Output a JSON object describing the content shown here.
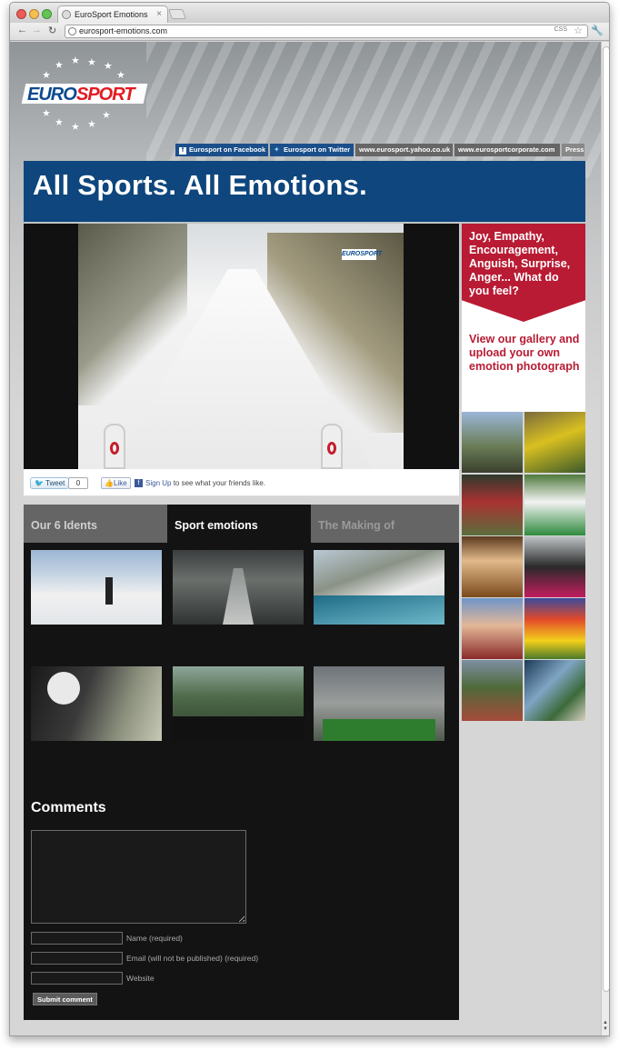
{
  "browser": {
    "tab_title": "EuroSport Emotions",
    "url": "eurosport-emotions.com",
    "url_badge": "CSS",
    "tab_close": "×"
  },
  "logo": {
    "part1": "EURO",
    "part2": "SPORT"
  },
  "topnav": [
    {
      "label": "Eurosport on Facebook"
    },
    {
      "label": "Eurosport on Twitter"
    },
    {
      "label": "www.eurosport.yahoo.co.uk"
    },
    {
      "label": "www.eurosportcorporate.com"
    },
    {
      "label": "Press"
    }
  ],
  "banner": {
    "title": "All Sports. All Emotions."
  },
  "video": {
    "watermark": "EUROSPORT"
  },
  "social": {
    "tweet_label": "Tweet",
    "tweet_count": "0",
    "like_label": "Like",
    "signup_link": "Sign Up",
    "signup_text": " to see what your friends like."
  },
  "content_tabs": [
    {
      "label": "Our 6 Idents",
      "active": false
    },
    {
      "label": "Sport emotions",
      "active": true
    },
    {
      "label": "The Making of",
      "active": false
    }
  ],
  "comments": {
    "heading": "Comments",
    "name_label": "Name (required)",
    "email_label": "Email (will not be published) (required)",
    "website_label": "Website",
    "submit_label": "Submit comment"
  },
  "sidebar": {
    "question": "Joy, Empathy, Encouragement, Anguish, Surprise, Anger... What do you feel?",
    "cta": "View our gallery and upload your own emotion photograph"
  },
  "colors": {
    "brand_blue": "#0e467d",
    "brand_red": "#b81b33",
    "content_bg": "#131313"
  }
}
